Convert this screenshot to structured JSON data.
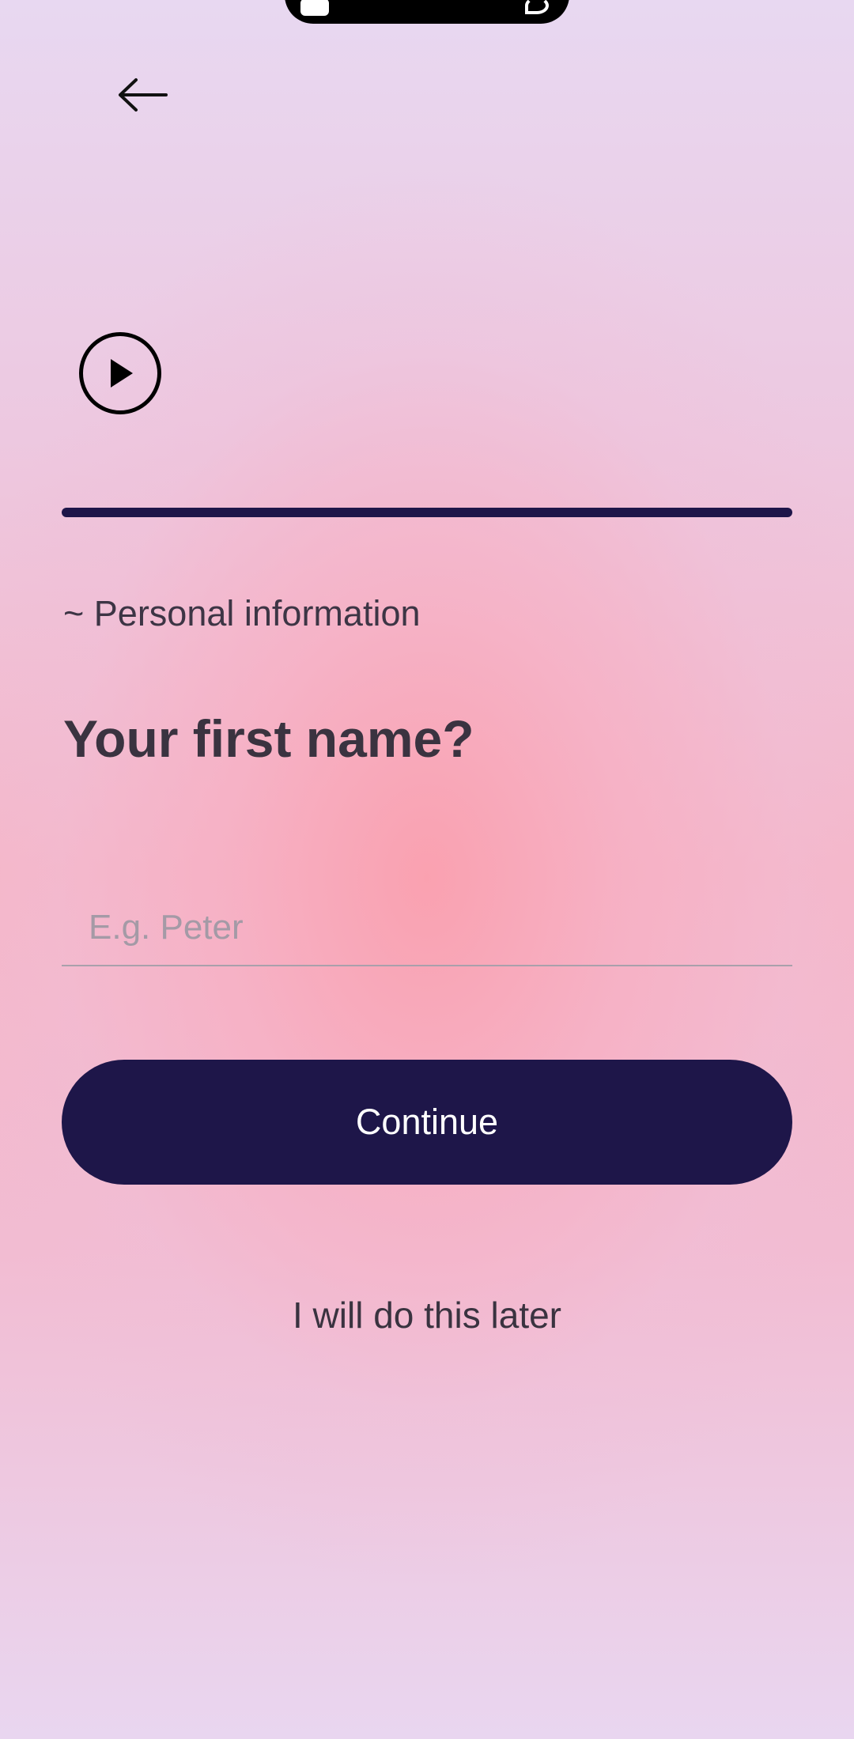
{
  "header": {
    "back_icon": "arrow-left-icon",
    "play_icon": "play-circle-icon"
  },
  "progress": {
    "value": 1.0,
    "color": "#1e1649"
  },
  "form": {
    "section_label": "~ Personal information",
    "question": "Your first name?",
    "first_name": {
      "value": "",
      "placeholder": "E.g. Peter"
    },
    "continue_label": "Continue",
    "later_label": "I will do this later"
  },
  "colors": {
    "accent": "#1e1649",
    "text": "#3a3340",
    "placeholder": "#a49aa6"
  }
}
